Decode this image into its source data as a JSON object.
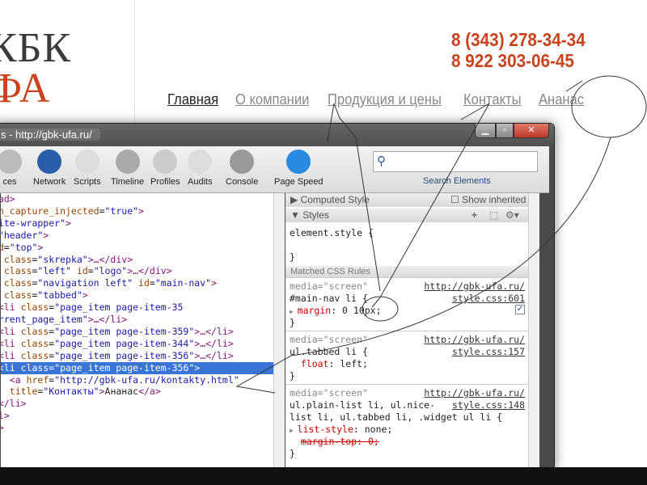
{
  "site": {
    "logo_top": "КБК",
    "logo_bottom": "ФА",
    "phone1": "8 (343) 278-34-34",
    "phone2": "8 922 303-06-45",
    "nav": [
      "Главная",
      "О компании",
      "Продукция и цены",
      "Контакты",
      "Ананас"
    ]
  },
  "devtools": {
    "title": "s - http://gbk-ufa.ru/",
    "tools": [
      {
        "label": "ces",
        "icon": "resources-icon"
      },
      {
        "label": "Network",
        "icon": "network-icon"
      },
      {
        "label": "Scripts",
        "icon": "scripts-icon"
      },
      {
        "label": "Timeline",
        "icon": "timeline-icon"
      },
      {
        "label": "Profiles",
        "icon": "profiles-icon"
      },
      {
        "label": "Audits",
        "icon": "audits-icon"
      },
      {
        "label": "Console",
        "icon": "console-icon"
      },
      {
        "label": "Page Speed",
        "icon": "page-speed-icon"
      }
    ],
    "search_label": "Search Elements",
    "dom_lines": [
      [
        [
          "tg",
          "ead>"
        ]
      ],
      [
        [
          "an",
          "en_capture_injected"
        ],
        [
          "tx",
          "="
        ],
        [
          "av",
          "\"true\""
        ],
        [
          "tg",
          ">"
        ]
      ],
      [
        [
          "av",
          "site-wrapper\""
        ],
        [
          "tg",
          ">"
        ]
      ],
      [
        [
          "tx",
          "="
        ],
        [
          "av",
          "\"header\""
        ],
        [
          "tg",
          ">"
        ]
      ],
      [
        [
          "an",
          "id"
        ],
        [
          "tx",
          "="
        ],
        [
          "av",
          "\"top\""
        ],
        [
          "tg",
          ">"
        ]
      ],
      [
        [
          "tg",
          "v "
        ],
        [
          "an",
          "class"
        ],
        [
          "tx",
          "="
        ],
        [
          "av",
          "\"skrepka\""
        ],
        [
          "tg",
          ">…</div>"
        ]
      ],
      [
        [
          "tg",
          "v "
        ],
        [
          "an",
          "class"
        ],
        [
          "tx",
          "="
        ],
        [
          "av",
          "\"left\" "
        ],
        [
          "an",
          "id"
        ],
        [
          "tx",
          "="
        ],
        [
          "av",
          "\"logo\""
        ],
        [
          "tg",
          ">…</div>"
        ]
      ],
      [
        [
          "tg",
          "v "
        ],
        [
          "an",
          "class"
        ],
        [
          "tx",
          "="
        ],
        [
          "av",
          "\"navigation left\" "
        ],
        [
          "an",
          "id"
        ],
        [
          "tx",
          "="
        ],
        [
          "av",
          "\"main-nav\""
        ],
        [
          "tg",
          ">"
        ]
      ],
      [
        [
          "tg",
          "l "
        ],
        [
          "an",
          "class"
        ],
        [
          "tx",
          "="
        ],
        [
          "av",
          "\"tabbed\""
        ],
        [
          "tg",
          ">"
        ]
      ],
      [
        [
          "tg",
          " <li "
        ],
        [
          "an",
          "class"
        ],
        [
          "tx",
          "="
        ],
        [
          "av",
          "\"page_item page-item-35"
        ]
      ],
      [
        [
          "av",
          "urrent_page_item\""
        ],
        [
          "tg",
          ">…</li>"
        ]
      ],
      [
        [
          "tg",
          " <li "
        ],
        [
          "an",
          "class"
        ],
        [
          "tx",
          "="
        ],
        [
          "av",
          "\"page_item page-item-359\""
        ],
        [
          "tg",
          ">…</li>"
        ]
      ],
      [
        [
          "tg",
          " <li "
        ],
        [
          "an",
          "class"
        ],
        [
          "tx",
          "="
        ],
        [
          "av",
          "\"page_item page-item-344\""
        ],
        [
          "tg",
          ">…</li>"
        ]
      ],
      [
        [
          "tg",
          " <li "
        ],
        [
          "an",
          "class"
        ],
        [
          "tx",
          "="
        ],
        [
          "av",
          "\"page_item page-item-356\""
        ],
        [
          "tg",
          ">…</li>"
        ]
      ],
      [
        [
          "tg",
          " <li "
        ],
        [
          "an",
          "class"
        ],
        [
          "tx",
          "="
        ],
        [
          "av",
          "\"page_item page-item-356\""
        ],
        [
          "tg",
          ">"
        ]
      ],
      [
        [
          "tg",
          "   <a "
        ],
        [
          "an",
          "href"
        ],
        [
          "tx",
          "="
        ],
        [
          "av",
          "\"http://gbk-ufa.ru/kontakty.html\""
        ]
      ],
      [
        [
          "an",
          "   title"
        ],
        [
          "tx",
          "="
        ],
        [
          "av",
          "\"Контакты\""
        ],
        [
          "tg",
          ">"
        ],
        [
          "tx",
          "Ананас"
        ],
        [
          "tg",
          "</a>"
        ]
      ],
      [
        [
          "tg",
          " </li>"
        ]
      ],
      [
        [
          "tg",
          "ul>"
        ]
      ],
      [
        [
          "tg",
          "v>"
        ]
      ],
      [
        [
          "tg",
          ">"
        ]
      ]
    ],
    "selected_line": 14,
    "computed_style": "▶ Computed Style",
    "show_inherited": "Show inherited",
    "styles": "▼ Styles",
    "element_style_open": "element.style {",
    "close": "}",
    "matched": "Matched CSS Rules",
    "rules": [
      {
        "media": "media=\"screen\"",
        "url": "http://gbk-ufa.ru/",
        "file": "style.css:601",
        "selector": "#main-nav li {",
        "props": [
          {
            "name": "margin",
            "value": "0 10px;",
            "expand": true,
            "checked": true
          }
        ]
      },
      {
        "media": "media=\"screen\"",
        "url": "http://gbk-ufa.ru/",
        "file": "style.css:157",
        "selector": "ul.tabbed li {",
        "props": [
          {
            "name": "float",
            "value": "left;"
          }
        ]
      },
      {
        "media": "media=\"screen\"",
        "url": "http://gbk-ufa.ru/",
        "file": "style.css:148",
        "selector": "ul.plain-list li, ul.nice-",
        "selector2": "list li, ul.tabbed li, .widget ul li {",
        "props": [
          {
            "name": "list-style",
            "value": "none;",
            "expand": true
          },
          {
            "name": "margin-top",
            "value": "0;",
            "struck": true
          }
        ]
      }
    ]
  },
  "colors": {
    "accent": "#c8431e",
    "selection": "#3875d7"
  }
}
